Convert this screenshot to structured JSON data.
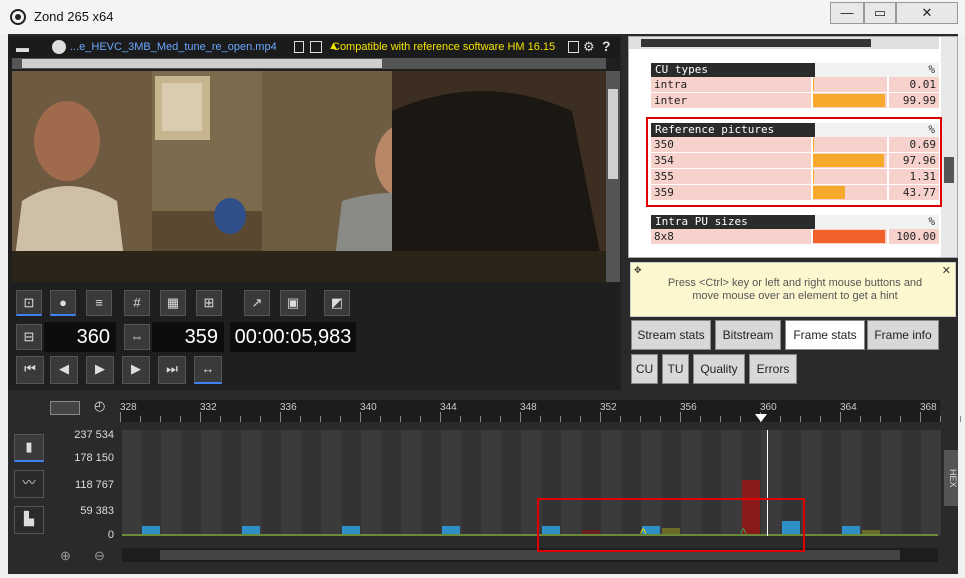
{
  "window": {
    "title": "Zond 265 x64",
    "controls": {
      "minimize": "—",
      "maximize": "▭",
      "close": "✕"
    }
  },
  "filebar": {
    "filename": "...e_HEVC_3MB_Med_tune_re_open.mp4",
    "compat": "Compatible with reference software HM 16.15"
  },
  "counters": {
    "current_frame": "360",
    "total_frames": "359",
    "timecode": "00:00:05,983"
  },
  "stats": {
    "cu_types": {
      "title": "CU types",
      "unit": "%",
      "rows": [
        {
          "label": "intra",
          "value": "0.01",
          "pct": 0.01
        },
        {
          "label": "inter",
          "value": "99.99",
          "pct": 99.99
        }
      ]
    },
    "ref_pictures": {
      "title": "Reference pictures",
      "unit": "%",
      "rows": [
        {
          "label": "350",
          "value": "0.69",
          "pct": 0.69
        },
        {
          "label": "354",
          "value": "97.96",
          "pct": 97.96
        },
        {
          "label": "355",
          "value": "1.31",
          "pct": 1.31
        },
        {
          "label": "359",
          "value": "43.77",
          "pct": 43.77
        }
      ]
    },
    "intra_pu": {
      "title": "Intra PU sizes",
      "unit": "%",
      "rows": [
        {
          "label": "8x8",
          "value": "100.00",
          "pct": 100.0
        }
      ]
    }
  },
  "hint": {
    "text": "Press <Ctrl> key or left and right mouse buttons and move mouse over an element to get a hint"
  },
  "tabs": {
    "row1": [
      "Stream stats",
      "Bitstream",
      "Frame stats",
      "Frame info"
    ],
    "row2": [
      "CU",
      "TU",
      "Quality",
      "Errors"
    ],
    "active": "Frame stats"
  },
  "timeline": {
    "ruler_ticks": [
      "328",
      "332",
      "336",
      "340",
      "344",
      "348",
      "352",
      "356",
      "360",
      "364",
      "368"
    ],
    "y_labels": [
      "237 534",
      "178 150",
      "118 767",
      "59 383",
      "0"
    ],
    "hex_label": "HEX"
  },
  "colors": {
    "accent_blue": "#2e8fc7",
    "red_frame": "#8b1a1a",
    "highlight": "#e00000",
    "bar_orange": "#f6a92a",
    "intra_bar": "#f0622a"
  }
}
